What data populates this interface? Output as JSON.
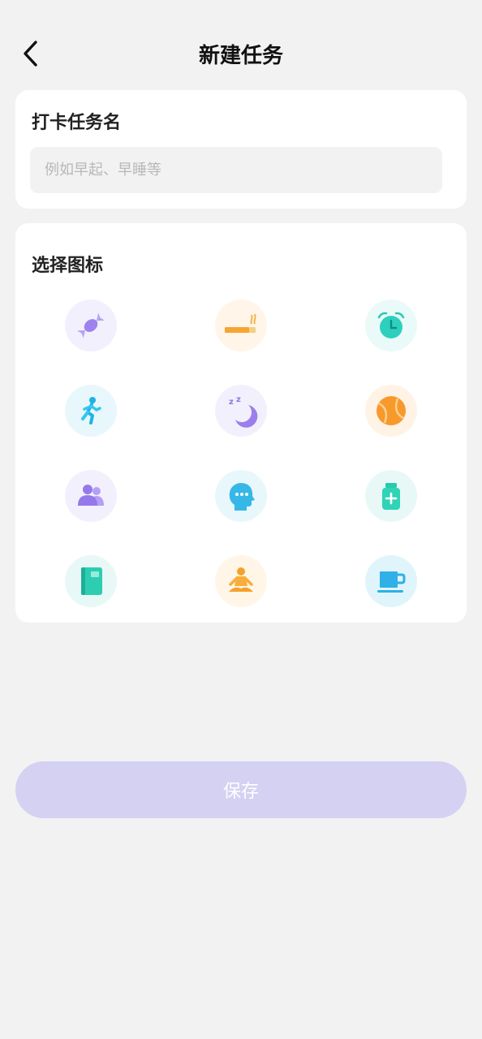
{
  "header": {
    "title": "新建任务",
    "back_icon": "chevron-left-icon"
  },
  "task_name": {
    "label": "打卡任务名",
    "placeholder": "例如早起、早睡等",
    "value": ""
  },
  "icon_picker": {
    "label": "选择图标",
    "icons": [
      {
        "name": "candy-icon",
        "bg": "#f3f0fd"
      },
      {
        "name": "cigarette-icon",
        "bg": "#fff5e8"
      },
      {
        "name": "alarm-clock-icon",
        "bg": "#eafaf8"
      },
      {
        "name": "running-person-icon",
        "bg": "#e8f7fc"
      },
      {
        "name": "sleep-moon-icon",
        "bg": "#f3f0fd"
      },
      {
        "name": "tennis-ball-icon",
        "bg": "#fff3e6"
      },
      {
        "name": "people-group-icon",
        "bg": "#f3f0fd"
      },
      {
        "name": "head-thinking-icon",
        "bg": "#e8f7fc"
      },
      {
        "name": "medicine-bottle-icon",
        "bg": "#e8f8f7"
      },
      {
        "name": "notebook-icon",
        "bg": "#e8f8f6"
      },
      {
        "name": "meditation-icon",
        "bg": "#fff6e8"
      },
      {
        "name": "coffee-cup-icon",
        "bg": "#dff5fb"
      }
    ]
  },
  "save_button": {
    "label": "保存",
    "color": "#d4d1f3"
  }
}
